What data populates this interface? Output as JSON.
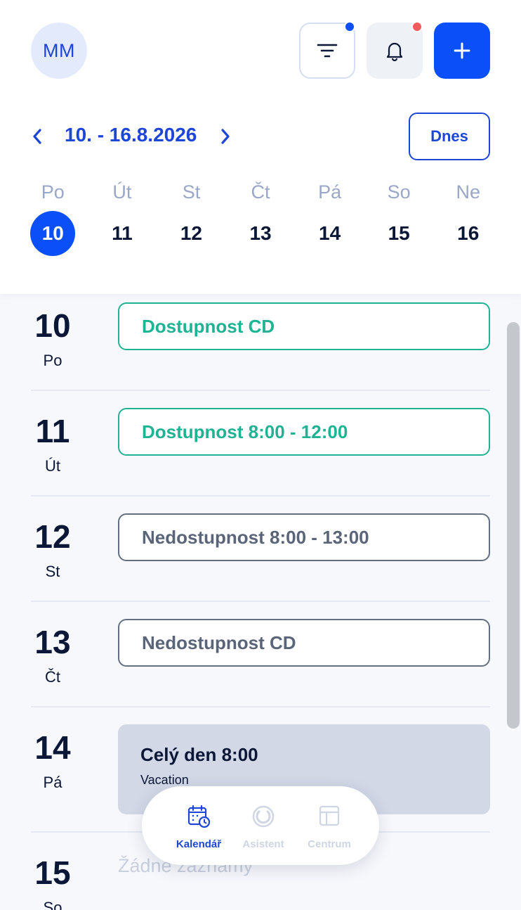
{
  "user": {
    "initials": "MM"
  },
  "colors": {
    "accent": "#0a4ff7",
    "available": "#1fb393",
    "unavailable": "#5a6579",
    "notification_dot": "#f25c5c"
  },
  "toolbar": {
    "filter_icon": "filter-icon",
    "bell_icon": "bell-icon",
    "add_icon": "plus-icon"
  },
  "week": {
    "range_label": "10. - 16.8.2026",
    "today_label": "Dnes",
    "days": [
      {
        "name": "Po",
        "num": "10",
        "selected": true
      },
      {
        "name": "Út",
        "num": "11"
      },
      {
        "name": "St",
        "num": "12"
      },
      {
        "name": "Čt",
        "num": "13"
      },
      {
        "name": "Pá",
        "num": "14"
      },
      {
        "name": "So",
        "num": "15"
      },
      {
        "name": "Ne",
        "num": "16"
      }
    ]
  },
  "agenda": [
    {
      "num": "10",
      "name": "Po",
      "event": "Dostupnost CD",
      "kind": "available"
    },
    {
      "num": "11",
      "name": "Út",
      "event": "Dostupnost 8:00 - 12:00",
      "kind": "available"
    },
    {
      "num": "12",
      "name": "St",
      "event": "Nedostupnost 8:00 - 13:00",
      "kind": "unavailable"
    },
    {
      "num": "13",
      "name": "Čt",
      "event": "Nedostupnost CD",
      "kind": "unavailable"
    },
    {
      "num": "14",
      "name": "Pá",
      "event": "Celý den 8:00",
      "subtitle": "Vacation",
      "kind": "block"
    },
    {
      "num": "15",
      "name": "So",
      "empty": "Žádne záznamy"
    }
  ],
  "tabs": [
    {
      "label": "Kalendář",
      "icon": "calendar-icon",
      "active": true
    },
    {
      "label": "Asistent",
      "icon": "assistant-icon"
    },
    {
      "label": "Centrum",
      "icon": "layout-icon"
    }
  ]
}
